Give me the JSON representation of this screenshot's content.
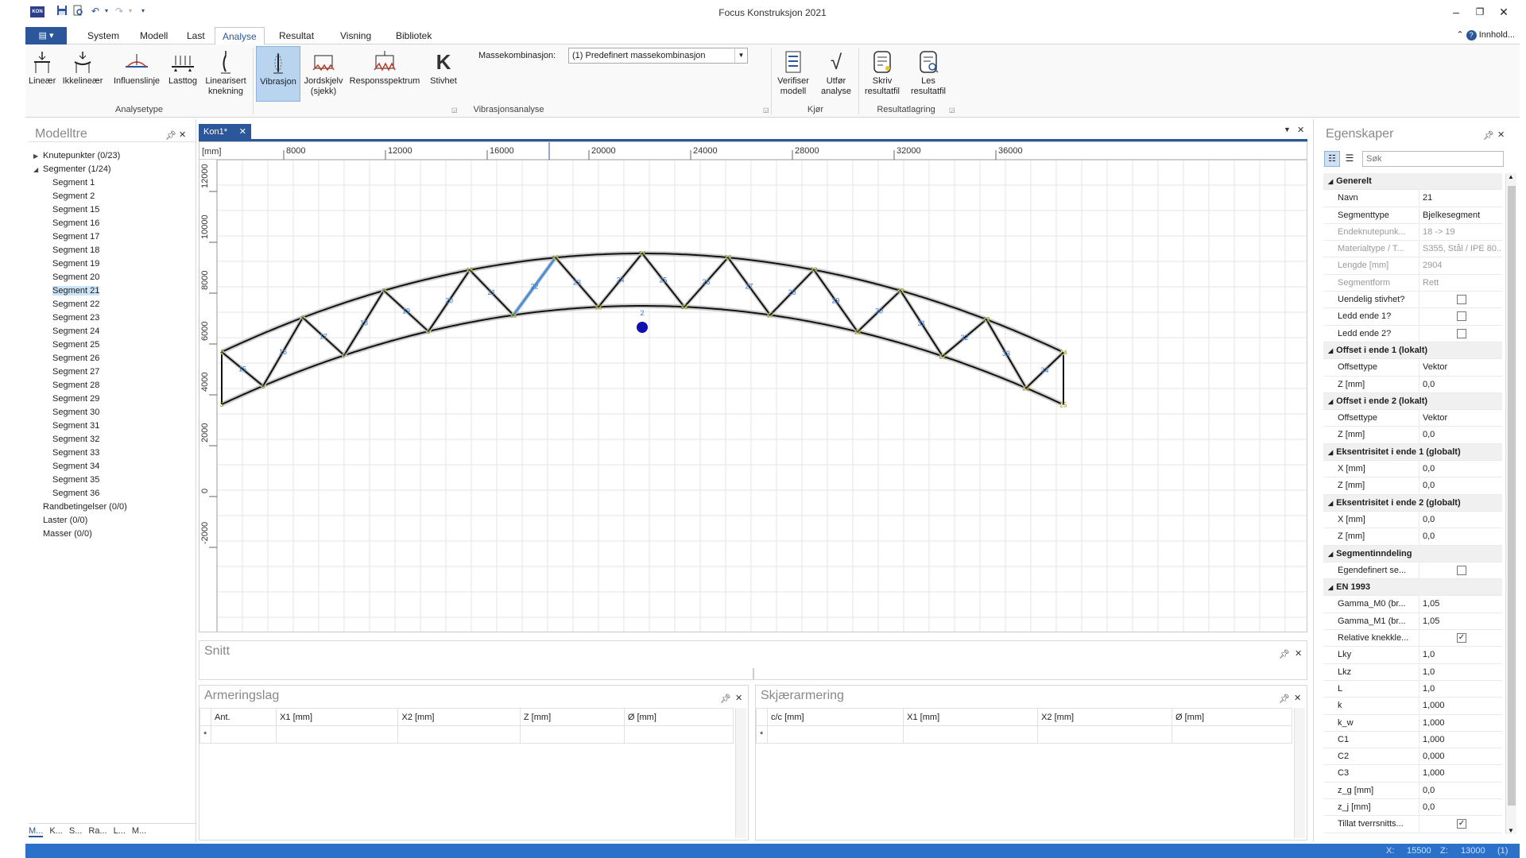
{
  "app": {
    "title": "Focus Konstruksjon 2021",
    "icon_text": "KON",
    "window_controls": [
      "minimize-icon",
      "restore-icon",
      "close-icon"
    ],
    "help_label": "Innhold..."
  },
  "ribbon": {
    "file_tab_glyph": "▤ ▾",
    "tabs": [
      "System",
      "Modell",
      "Last",
      "Analyse",
      "Resultat",
      "Visning",
      "Bibliotek"
    ],
    "active_tab": "Analyse",
    "analysetype": {
      "label": "Analysetype",
      "buttons": [
        "Lineær",
        "Ikkelineær",
        "Influenslinje",
        "Lasttog",
        "Linearisert knekning"
      ]
    },
    "vibrasjonsanalyse": {
      "label": "Vibrasjonsanalyse",
      "buttons": [
        "Vibrasjon",
        "Jordskjelv (sjekk)",
        "Responsspektrum",
        "Stivhet"
      ],
      "selected": "Vibrasjon",
      "massekombinasjon_label": "Massekombinasjon:",
      "massekombinasjon_value": "(1) Predefinert massekombinasjon"
    },
    "kjor": {
      "label": "Kjør",
      "buttons": [
        "Verifiser modell",
        "Utfør analyse"
      ]
    },
    "resultatlagring": {
      "label": "Resultatlagring",
      "buttons": [
        "Skriv resultatfil",
        "Les resultatfil"
      ]
    }
  },
  "modelltre": {
    "title": "Modelltre",
    "items": [
      {
        "label": "Knutepunkter (0/23)",
        "level": 0,
        "arrow": "▶"
      },
      {
        "label": "Segmenter (1/24)",
        "level": 0,
        "arrow": "◢"
      },
      {
        "label": "Segment 1",
        "level": 1
      },
      {
        "label": "Segment 2",
        "level": 1
      },
      {
        "label": "Segment 15",
        "level": 1
      },
      {
        "label": "Segment 16",
        "level": 1
      },
      {
        "label": "Segment 17",
        "level": 1
      },
      {
        "label": "Segment 18",
        "level": 1
      },
      {
        "label": "Segment 19",
        "level": 1
      },
      {
        "label": "Segment 20",
        "level": 1
      },
      {
        "label": "Segment 21",
        "level": 1,
        "selected": true
      },
      {
        "label": "Segment 22",
        "level": 1
      },
      {
        "label": "Segment 23",
        "level": 1
      },
      {
        "label": "Segment 24",
        "level": 1
      },
      {
        "label": "Segment 25",
        "level": 1
      },
      {
        "label": "Segment 26",
        "level": 1
      },
      {
        "label": "Segment 27",
        "level": 1
      },
      {
        "label": "Segment 28",
        "level": 1
      },
      {
        "label": "Segment 29",
        "level": 1
      },
      {
        "label": "Segment 30",
        "level": 1
      },
      {
        "label": "Segment 31",
        "level": 1
      },
      {
        "label": "Segment 32",
        "level": 1
      },
      {
        "label": "Segment 33",
        "level": 1
      },
      {
        "label": "Segment 34",
        "level": 1
      },
      {
        "label": "Segment 35",
        "level": 1
      },
      {
        "label": "Segment 36",
        "level": 1
      },
      {
        "label": "Randbetingelser (0/0)",
        "level": 0
      },
      {
        "label": "Laster (0/0)",
        "level": 0
      },
      {
        "label": "Masser (0/0)",
        "level": 0
      }
    ],
    "bottom_tabs": [
      "M...",
      "K...",
      "S...",
      "Ra...",
      "L...",
      "M..."
    ]
  },
  "document": {
    "tab_label": "Kon1*",
    "unit_label": "[mm]",
    "x_ticks": [
      "8000",
      "12000",
      "16000",
      "20000",
      "24000",
      "28000",
      "32000",
      "36000"
    ],
    "y_ticks": [
      "12000",
      "10000",
      "8000",
      "6000",
      "4000",
      "2000",
      "0",
      "-2000"
    ],
    "top_nodes": [
      "4",
      "6",
      "8",
      "10",
      "12",
      "14",
      "16",
      "18",
      "20",
      "22",
      "24",
      "26",
      "28",
      "2"
    ],
    "bottom_nodes": [
      "3",
      "5",
      "7",
      "9",
      "11",
      "13",
      "15",
      "17",
      "19",
      "21",
      "23",
      "25",
      "27",
      "1"
    ],
    "segment_labels": [
      "15",
      "16",
      "17",
      "18",
      "19",
      "20",
      "21",
      "22",
      "23",
      "24",
      "25",
      "26",
      "27",
      "28",
      "29",
      "30",
      "31",
      "32",
      "33",
      "34",
      "35",
      "36",
      "2",
      "1"
    ]
  },
  "snitt": {
    "title": "Snitt"
  },
  "armeringslag": {
    "title": "Armeringslag",
    "columns": [
      "Ant.",
      "X1 [mm]",
      "X2 [mm]",
      "Z [mm]",
      "Ø [mm]"
    ],
    "new_row_marker": "*"
  },
  "skjaerarmering": {
    "title": "Skjærarmering",
    "columns": [
      "c/c [mm]",
      "X1 [mm]",
      "X2 [mm]",
      "Ø [mm]"
    ],
    "new_row_marker": "*"
  },
  "egenskaper": {
    "title": "Egenskaper",
    "search_placeholder": "Søk",
    "rows": [
      {
        "type": "cat",
        "k": "Generelt"
      },
      {
        "k": "Navn",
        "v": "21"
      },
      {
        "k": "Segmenttype",
        "v": "Bjelkesegment"
      },
      {
        "k": "Endeknutepunk...",
        "v": "18 -> 19",
        "ro": true
      },
      {
        "k": "Materialtype / T...",
        "v": "S355, Stål / IPE 80...",
        "ro": true
      },
      {
        "k": "Lengde [mm]",
        "v": "2904",
        "ro": true
      },
      {
        "k": "Segmentform",
        "v": "Rett",
        "ro": true
      },
      {
        "k": "Uendelig stivhet?",
        "chk": false
      },
      {
        "k": "Ledd ende 1?",
        "chk": false
      },
      {
        "k": "Ledd ende 2?",
        "chk": false
      },
      {
        "type": "cat",
        "k": "Offset i ende 1 (lokalt)"
      },
      {
        "k": "Offsettype",
        "v": "Vektor"
      },
      {
        "k": "Z [mm]",
        "v": "0,0"
      },
      {
        "type": "cat",
        "k": "Offset i ende 2 (lokalt)"
      },
      {
        "k": "Offsettype",
        "v": "Vektor"
      },
      {
        "k": "Z [mm]",
        "v": "0,0"
      },
      {
        "type": "cat",
        "k": "Eksentrisitet i ende 1 (globalt)"
      },
      {
        "k": "X [mm]",
        "v": "0,0"
      },
      {
        "k": "Z [mm]",
        "v": "0,0"
      },
      {
        "type": "cat",
        "k": "Eksentrisitet i ende 2 (globalt)"
      },
      {
        "k": "X [mm]",
        "v": "0,0"
      },
      {
        "k": "Z [mm]",
        "v": "0,0"
      },
      {
        "type": "cat",
        "k": "Segmentinndeling"
      },
      {
        "k": "Egendefinert se...",
        "chk": false
      },
      {
        "type": "cat",
        "k": "EN 1993"
      },
      {
        "k": "Gamma_M0 (br...",
        "v": "1,05"
      },
      {
        "k": "Gamma_M1 (br...",
        "v": "1,05"
      },
      {
        "k": "Relative knekkle...",
        "chk": true
      },
      {
        "k": "Lky",
        "v": "1,0"
      },
      {
        "k": "Lkz",
        "v": "1,0"
      },
      {
        "k": "L",
        "v": "1,0"
      },
      {
        "k": "k",
        "v": "1,000"
      },
      {
        "k": "k_w",
        "v": "1,000"
      },
      {
        "k": "C1",
        "v": "1,000"
      },
      {
        "k": "C2",
        "v": "0,000"
      },
      {
        "k": "C3",
        "v": "1,000"
      },
      {
        "k": "z_g [mm]",
        "v": "0,0"
      },
      {
        "k": "z_j [mm]",
        "v": "0,0"
      },
      {
        "k": "Tillat tverrsnitts...",
        "chk": true
      }
    ]
  },
  "status": {
    "x_label": "X:",
    "x_value": "15500",
    "z_label": "Z:",
    "z_value": "13000",
    "extra": "(1)"
  },
  "colors": {
    "accent": "#2b579a",
    "selected_segment": "#4a90d9",
    "node_label": "#8a8a00",
    "segment_label": "#3a78c8",
    "point_marker": "#1010b0"
  }
}
